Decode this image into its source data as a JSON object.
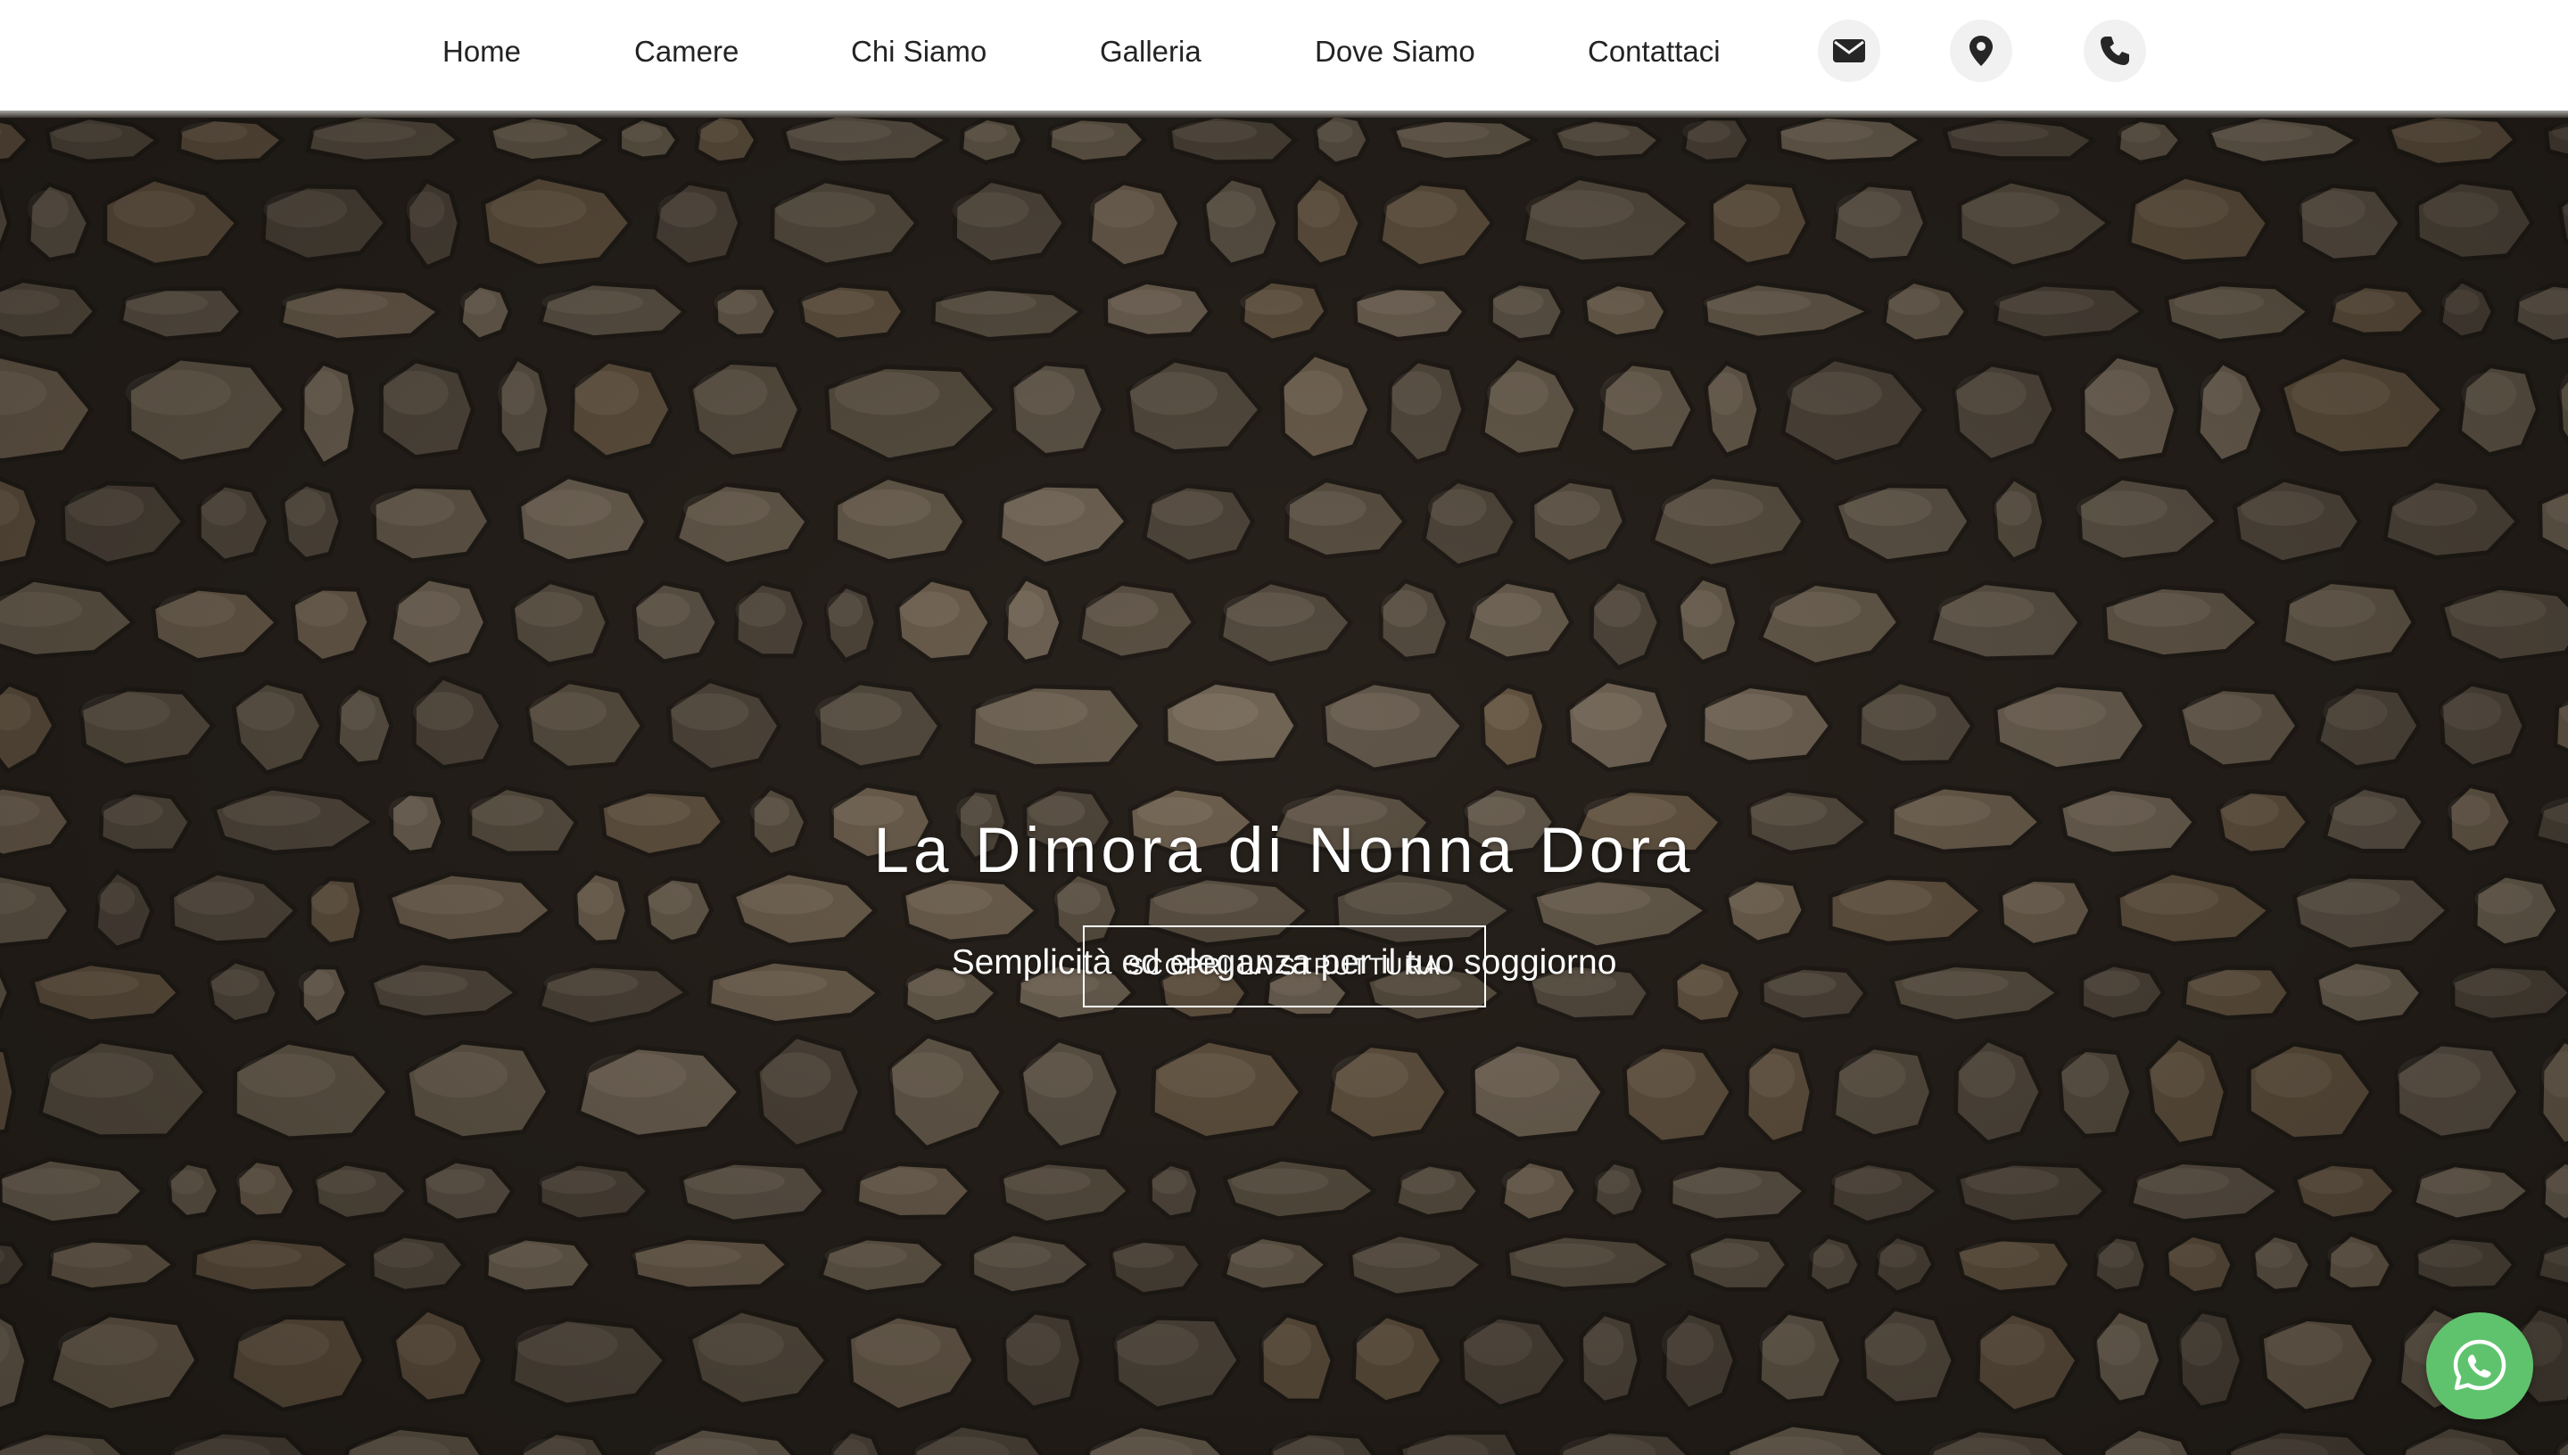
{
  "nav": {
    "items": [
      {
        "label": "Home"
      },
      {
        "label": "Camere"
      },
      {
        "label": "Chi Siamo"
      },
      {
        "label": "Galleria"
      },
      {
        "label": "Dove Siamo"
      },
      {
        "label": "Contattaci"
      }
    ],
    "icons": [
      "envelope-icon",
      "map-pin-icon",
      "phone-icon"
    ]
  },
  "hero": {
    "title": "La Dimora di Nonna Dora",
    "subtitle": "Semplicità ed eleganza per il tuo soggiorno",
    "cta_label": "SCOPRI LA STRUTTURA",
    "background": "stone-wall"
  },
  "whatsapp": {
    "icon": "whatsapp-icon",
    "color": "#5fc36d"
  },
  "colors": {
    "nav_background": "#ffffff",
    "nav_text": "#232323",
    "icon_button_bg": "#f1f1f1",
    "hero_text": "#ffffff"
  }
}
